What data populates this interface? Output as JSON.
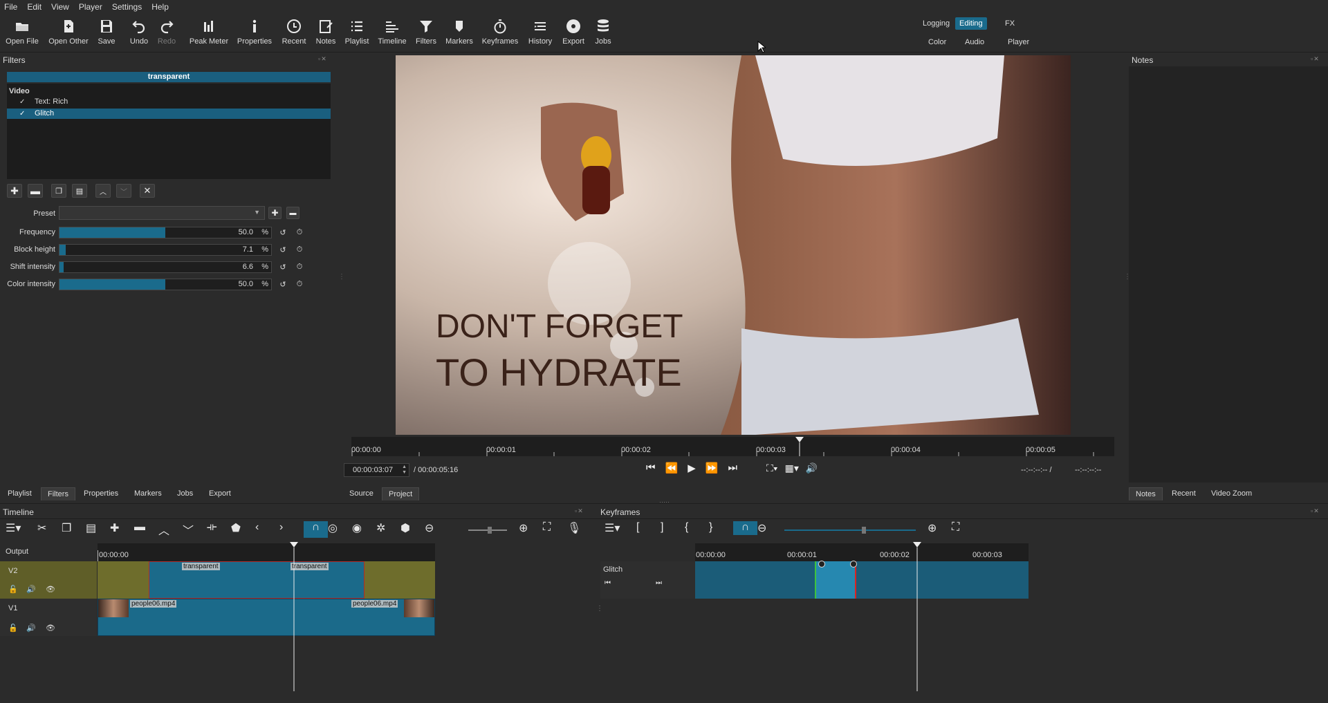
{
  "menu": [
    "File",
    "Edit",
    "View",
    "Player",
    "Settings",
    "Help"
  ],
  "toolbar": {
    "buttons": [
      {
        "label": "Open File",
        "icon": "folder-open-icon"
      },
      {
        "label": "Open Other",
        "icon": "open-other-icon"
      },
      {
        "label": "Save",
        "icon": "save-icon"
      },
      {
        "label": "Undo",
        "icon": "undo-icon"
      },
      {
        "label": "Redo",
        "icon": "redo-icon"
      },
      {
        "label": "Peak Meter",
        "icon": "peak-meter-icon"
      },
      {
        "label": "Properties",
        "icon": "info-icon"
      },
      {
        "label": "Recent",
        "icon": "clock-icon"
      },
      {
        "label": "Notes",
        "icon": "notes-icon"
      },
      {
        "label": "Playlist",
        "icon": "playlist-icon"
      },
      {
        "label": "Timeline",
        "icon": "timeline-icon"
      },
      {
        "label": "Filters",
        "icon": "filter-icon"
      },
      {
        "label": "Markers",
        "icon": "marker-icon"
      },
      {
        "label": "Keyframes",
        "icon": "stopwatch-icon"
      },
      {
        "label": "History",
        "icon": "history-icon"
      },
      {
        "label": "Export",
        "icon": "export-icon"
      },
      {
        "label": "Jobs",
        "icon": "jobs-icon"
      }
    ],
    "layouts": {
      "logging": "Logging",
      "editing": "Editing",
      "fx": "FX",
      "color": "Color",
      "audio": "Audio",
      "player": "Player"
    }
  },
  "filters_panel": {
    "title": "Filters",
    "clip_name": "transparent",
    "category": "Video",
    "items": [
      {
        "check": "✓",
        "label": "Text: Rich"
      },
      {
        "check": "✓",
        "label": "Glitch"
      }
    ],
    "preset_label": "Preset",
    "params": [
      {
        "label": "Frequency",
        "value": "50.0",
        "unit": "%",
        "fraction": 0.5
      },
      {
        "label": "Block height",
        "value": "7.1",
        "unit": "%",
        "fraction": 0.03
      },
      {
        "label": "Shift intensity",
        "value": "6.6",
        "unit": "%",
        "fraction": 0.02
      },
      {
        "label": "Color intensity",
        "value": "50.0",
        "unit": "%",
        "fraction": 0.5
      }
    ]
  },
  "left_tabs": [
    "Playlist",
    "Filters",
    "Properties",
    "Markers",
    "Jobs",
    "Export"
  ],
  "viewer": {
    "overlay_line1": "DON'T FORGET",
    "overlay_line2": "TO HYDRATE",
    "ruler_ticks": [
      "00:00:00",
      "00:00:01",
      "00:00:02",
      "00:00:03",
      "00:00:04",
      "00:00:05"
    ],
    "current_time": "00:00:03:07",
    "total_time": "/ 00:00:05:16",
    "in_point": "--:--:--:-- /",
    "out_point": "--:--:--:--",
    "tabs": [
      "Source",
      "Project"
    ]
  },
  "notes_panel": {
    "title": "Notes",
    "tabs": [
      "Notes",
      "Recent",
      "Video Zoom"
    ]
  },
  "timeline": {
    "title": "Timeline",
    "output_label": "Output",
    "ruler_start": "00:00:00",
    "tracks": [
      {
        "name": "V2",
        "clips": [
          "transparent",
          "transparent"
        ]
      },
      {
        "name": "V1",
        "clips": [
          "people06.mp4",
          "people06.mp4"
        ]
      }
    ]
  },
  "keyframes": {
    "title": "Keyframes",
    "track_label": "Glitch",
    "ruler_ticks": [
      "00:00:00",
      "00:00:01",
      "00:00:02",
      "00:00:03"
    ]
  },
  "colors": {
    "accent": "#1a6b8c",
    "selection": "#1a5f7f",
    "v2_track": "#6e6d2c"
  }
}
